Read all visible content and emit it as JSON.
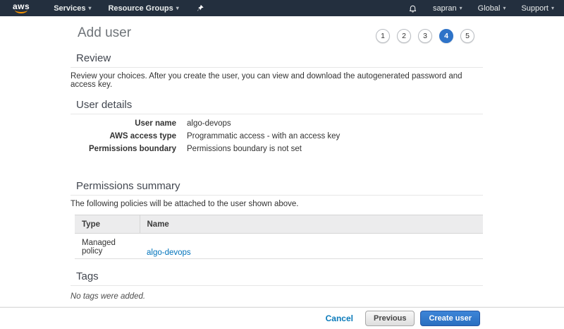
{
  "nav": {
    "logo": "aws",
    "left_items": [
      {
        "label": "Services"
      },
      {
        "label": "Resource Groups"
      }
    ],
    "right_items": [
      {
        "label": "sapran"
      },
      {
        "label": "Global"
      },
      {
        "label": "Support"
      }
    ]
  },
  "icons": {
    "caret_glyph": "▾",
    "bell": "notification-bell",
    "pin": "pushpin"
  },
  "page": {
    "title": "Add user"
  },
  "steps": {
    "items": [
      "1",
      "2",
      "3",
      "4",
      "5"
    ],
    "active_step": "4",
    "active_color": "#2e73c8"
  },
  "review": {
    "heading": "Review",
    "description": "Review your choices. After you create the user, you can view and download the autogenerated password and access key."
  },
  "user_details": {
    "heading": "User details",
    "rows": [
      {
        "label": "User name",
        "value": "algo-devops"
      },
      {
        "label": "AWS access type",
        "value": "Programmatic access - with an access key"
      },
      {
        "label": "Permissions boundary",
        "value": "Permissions boundary is not set"
      }
    ]
  },
  "permissions": {
    "heading": "Permissions summary",
    "description": "The following policies will be attached to the user shown above.",
    "table": {
      "headers": [
        "Type",
        "Name"
      ],
      "rows": [
        {
          "type": "Managed policy",
          "name": "algo-devops"
        }
      ]
    }
  },
  "tags": {
    "heading": "Tags",
    "empty_text": "No tags were added."
  },
  "footer": {
    "cancel_label": "Cancel",
    "previous_label": "Previous",
    "create_label": "Create user"
  },
  "colors": {
    "nav_background": "#232f3e",
    "logo_smile": "#f79400",
    "accent_blue": "#2e73c8",
    "link_blue": "#0073bb"
  }
}
